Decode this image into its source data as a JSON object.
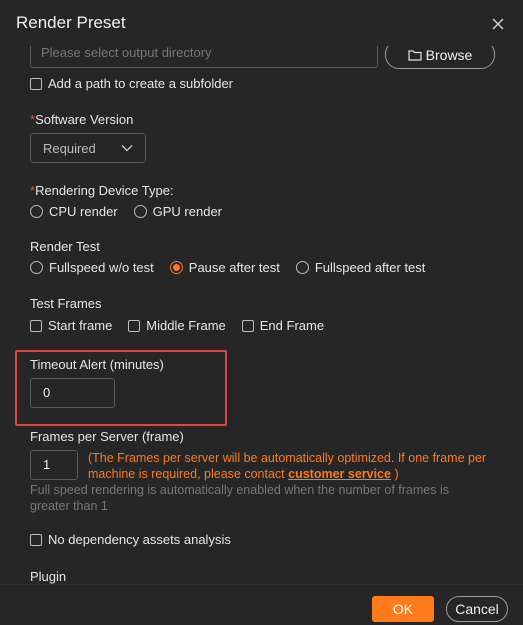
{
  "dialog": {
    "title": "Render Preset"
  },
  "output": {
    "dir_placeholder": "Please select output directory",
    "browse_label": "Browse",
    "subfolder_label": "Add a path to create a subfolder"
  },
  "software": {
    "label": "Software Version",
    "value": "Required"
  },
  "device": {
    "label": "Rendering Device Type:",
    "options": [
      "CPU render",
      "GPU render"
    ]
  },
  "render_test": {
    "label": "Render Test",
    "options": [
      "Fullspeed w/o test",
      "Pause after test",
      "Fullspeed after test"
    ],
    "selected": "Pause after test"
  },
  "test_frames": {
    "label": "Test Frames",
    "options": [
      "Start frame",
      "Middle Frame",
      "End Frame"
    ]
  },
  "timeout": {
    "label": "Timeout Alert (minutes)",
    "value": "0"
  },
  "frames_per_server": {
    "label": "Frames per Server (frame)",
    "value": "1",
    "note_text": "(The Frames per server will be automatically optimized. If one frame per machine is required, please contact",
    "note_link": "customer service",
    "note_end": ")",
    "hint": "Full speed rendering is automatically enabled when the number of frames is greater than 1"
  },
  "dependency": {
    "label": "No dependency assets analysis"
  },
  "plugin": {
    "label": "Plugin"
  },
  "footer": {
    "ok": "OK",
    "cancel": "Cancel"
  },
  "colors": {
    "accent": "#ff7a1a",
    "highlight": "#e04545",
    "background": "#262626"
  },
  "icons": {
    "close": "close-icon",
    "folder": "folder-icon",
    "dropdown": "chevron-down-icon"
  }
}
